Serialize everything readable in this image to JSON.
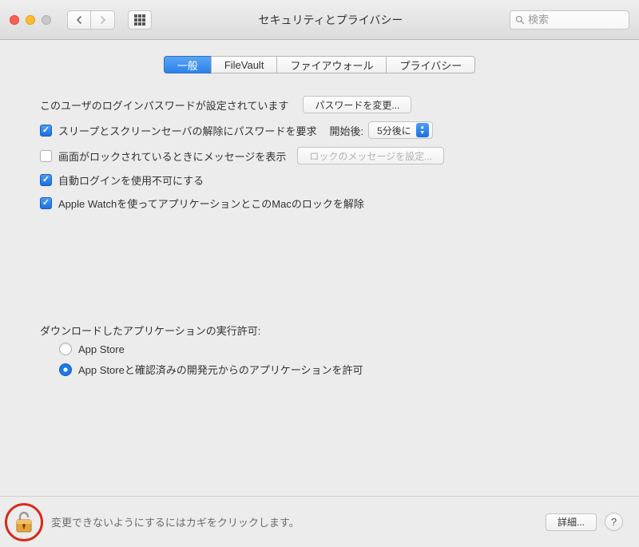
{
  "window": {
    "title": "セキュリティとプライバシー"
  },
  "search": {
    "placeholder": "検索"
  },
  "tabs": {
    "general": "一般",
    "filevault": "FileVault",
    "firewall": "ファイアウォール",
    "privacy": "プライバシー"
  },
  "general": {
    "password_set_label": "このユーザのログインパスワードが設定されています",
    "change_password_button": "パスワードを変更...",
    "require_password_label": "スリープとスクリーンセーバの解除にパスワードを要求",
    "require_after_label": "開始後:",
    "require_after_value": "5分後に",
    "show_lock_message_label": "画面がロックされているときにメッセージを表示",
    "set_lock_message_button": "ロックのメッセージを設定...",
    "disable_auto_login_label": "自動ログインを使用不可にする",
    "apple_watch_label": "Apple Watchを使ってアプリケーションとこのMacのロックを解除",
    "checkbox_states": {
      "require_password": true,
      "show_lock_message": false,
      "disable_auto_login": true,
      "apple_watch": true
    }
  },
  "downloads": {
    "section_title": "ダウンロードしたアプリケーションの実行許可:",
    "options": {
      "app_store": "App Store",
      "identified": "App Storeと確認済みの開発元からのアプリケーションを許可"
    },
    "selected": "identified"
  },
  "footer": {
    "lock_hint": "変更できないようにするにはカギをクリックします。",
    "advanced_button": "詳細..."
  }
}
